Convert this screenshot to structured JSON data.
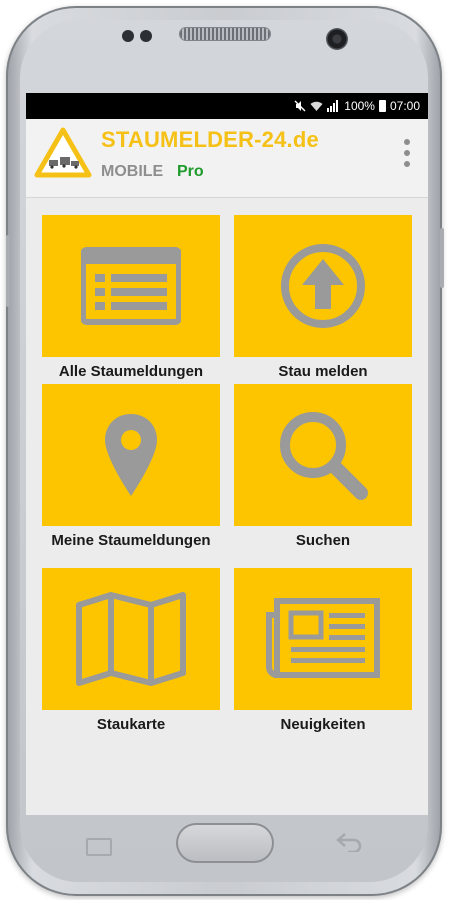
{
  "status_bar": {
    "battery_percent": "100%",
    "time": "07:00",
    "icons": [
      "mute-icon",
      "wifi-icon",
      "signal-icon",
      "battery-icon"
    ]
  },
  "app": {
    "title": "STAUMELDER-24.de",
    "subtitle": "MOBILE",
    "tier": "Pro",
    "title_color": "#f5c116",
    "tier_color": "#1f9b2c"
  },
  "tiles": [
    {
      "label": "Alle Staumeldungen",
      "icon": "list-icon"
    },
    {
      "label": "Stau melden",
      "icon": "upload-arrow-icon"
    },
    {
      "label": "Meine Staumeldungen",
      "icon": "map-pin-icon"
    },
    {
      "label": "Suchen",
      "icon": "search-icon"
    },
    {
      "label": "Staukarte",
      "icon": "folded-map-icon"
    },
    {
      "label": "Neuigkeiten",
      "icon": "newspaper-icon"
    }
  ],
  "colors": {
    "tile_yellow": "#fcc500",
    "icon_gray": "#9a9a9a"
  }
}
